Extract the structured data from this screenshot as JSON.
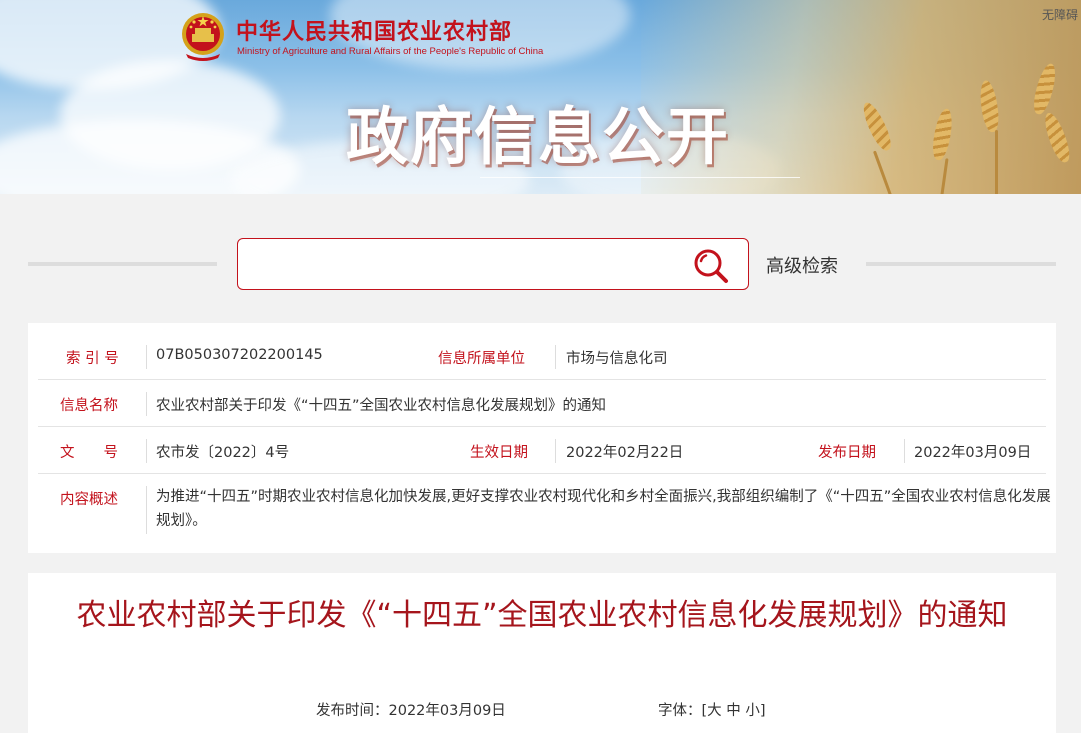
{
  "header": {
    "ministry_cn": "中华人民共和国农业农村部",
    "ministry_en": "Ministry of Agriculture and Rural Affairs of the People's Republic of China",
    "banner_title": "政府信息公开",
    "accessible_label": "无障碍"
  },
  "search": {
    "placeholder": "",
    "value": "",
    "advanced_label": "高级检索"
  },
  "info": {
    "index_label": "索 引 号",
    "index_value": "07B050307202200145",
    "unit_label": "信息所属单位",
    "unit_value": "市场与信息化司",
    "name_label": "信息名称",
    "name_value": "农业农村部关于印发《“十四五”全国农业农村信息化发展规划》的通知",
    "doc_label": "文　　号",
    "doc_value": "农市发〔2022〕4号",
    "effective_label": "生效日期",
    "effective_value": "2022年02月22日",
    "publish_label": "发布日期",
    "publish_value": "2022年03月09日",
    "summary_label": "内容概述",
    "summary_value": "为推进“十四五”时期农业农村信息化加快发展,更好支撑农业农村现代化和乡村全面振兴,我部组织编制了《“十四五”全国农业农村信息化发展规划》。"
  },
  "article": {
    "title": "农业农村部关于印发《“十四五”全国农业农村信息化发展规划》的通知",
    "publish_time": "发布时间：2022年03月09日",
    "font_label": "字体：",
    "font_open": "[",
    "font_large": "大",
    "font_medium": "中",
    "font_small": "小",
    "font_close": "]"
  },
  "colors": {
    "brand_red": "#c3121c",
    "title_red": "#a5151c"
  }
}
